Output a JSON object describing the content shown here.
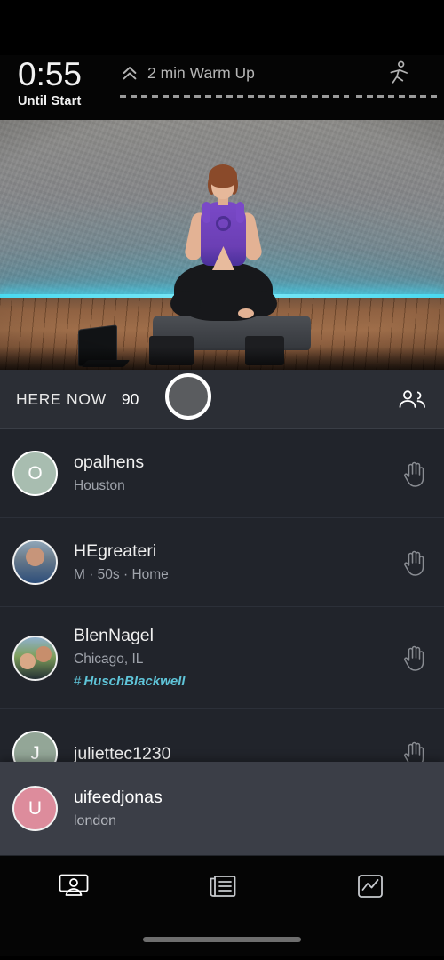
{
  "header": {
    "timer_value": "0:55",
    "timer_label": "Until Start",
    "segment_title": "2 min Warm Up",
    "chevron_icon": "chevron-double-up-icon",
    "workout_icon": "exercise-figure-icon"
  },
  "video": {
    "scene_description": "yoga instructor seated in lotus pose on mat"
  },
  "here_now": {
    "label": "HERE NOW",
    "count": "90",
    "people_icon": "people-group-icon",
    "knob_icon": "scroll-knob"
  },
  "members": [
    {
      "username": "opalhens",
      "subtitle": "Houston",
      "tag": "",
      "avatar_initial": "O",
      "avatar_type": "initial",
      "avatar_color": "#a8bdb0",
      "action_icon": "raised-hand-icon"
    },
    {
      "username": "HEgreateri",
      "subtitle": "M  ·  50s  ·  Home",
      "tag": "",
      "avatar_initial": "",
      "avatar_type": "photo",
      "avatar_color": "#6b7c8c",
      "action_icon": "raised-hand-icon"
    },
    {
      "username": "BlenNagel",
      "subtitle": "Chicago, IL",
      "tag": "HuschBlackwell",
      "tag_hash": "#",
      "avatar_initial": "",
      "avatar_type": "photo",
      "avatar_color": "#7fa05c",
      "action_icon": "raised-hand-icon"
    },
    {
      "username": "juliettec1230",
      "subtitle": "",
      "tag": "",
      "avatar_initial": "J",
      "avatar_type": "initial",
      "avatar_color": "#93a697",
      "action_icon": "raised-hand-icon"
    }
  ],
  "overlay_member": {
    "username": "uifeedjonas",
    "subtitle": "london",
    "avatar_initial": "U",
    "avatar_color": "#dd8c9c"
  },
  "bottom_nav": [
    {
      "icon": "live-class-screen-icon",
      "active": "true"
    },
    {
      "icon": "schedule-list-icon",
      "active": "false"
    },
    {
      "icon": "activity-chart-icon",
      "active": "false"
    }
  ],
  "colors": {
    "accent_cyan": "#5fc4d8",
    "neon": "#49d9ef",
    "bar_bg": "#2b2e35",
    "list_bg": "#21242b",
    "overlay_bg": "#3b3e47"
  }
}
